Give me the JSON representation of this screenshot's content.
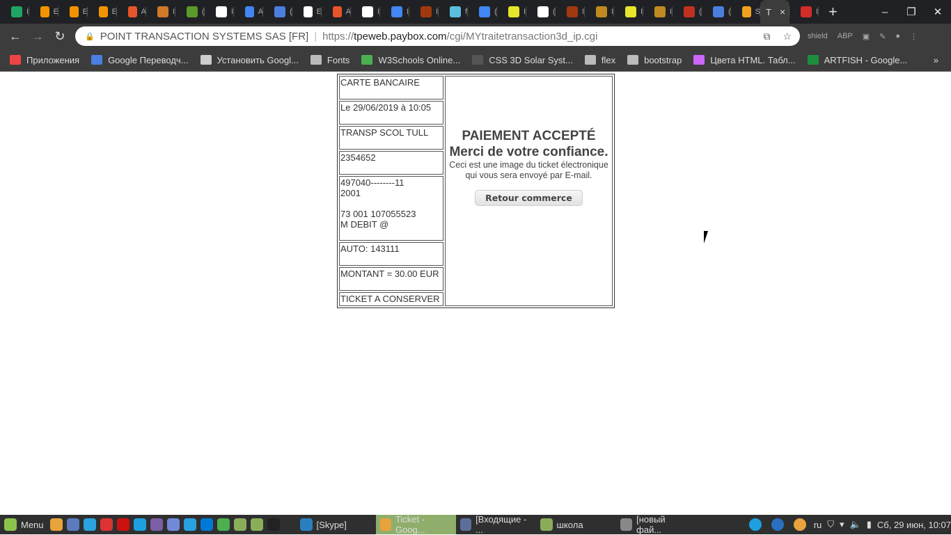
{
  "browser": {
    "tabs": [
      {
        "icon": "google-drive-icon",
        "color": "#1fa463",
        "label": "I"
      },
      {
        "icon": "af-icon",
        "color": "#f29400",
        "label": "E"
      },
      {
        "icon": "af-icon",
        "color": "#f29400",
        "label": "E"
      },
      {
        "icon": "af-icon",
        "color": "#f29400",
        "label": "E"
      },
      {
        "icon": "asterisk-icon",
        "color": "#e8542a",
        "label": "A"
      },
      {
        "icon": "mountain-icon",
        "color": "#d07a28",
        "label": "I"
      },
      {
        "icon": "frog-icon",
        "color": "#5a9a2a",
        "label": "("
      },
      {
        "icon": "globe-icon",
        "color": "#ffffff",
        "label": "I"
      },
      {
        "icon": "google-icon",
        "color": "#4285f4",
        "label": "A"
      },
      {
        "icon": "google-translate-icon",
        "color": "#4a7fe0",
        "label": "("
      },
      {
        "icon": "globe-icon",
        "color": "#ffffff",
        "label": "E"
      },
      {
        "icon": "asterisk-icon",
        "color": "#e8542a",
        "label": "A"
      },
      {
        "icon": "globe-icon",
        "color": "#ffffff",
        "label": "I"
      },
      {
        "icon": "google-icon",
        "color": "#4285f4",
        "label": "I"
      },
      {
        "icon": "blocks-icon",
        "color": "#a0380f",
        "label": "I"
      },
      {
        "icon": "codepen-cloud-icon",
        "color": "#5bc0de",
        "label": "f"
      },
      {
        "icon": "google-icon",
        "color": "#4285f4",
        "label": "("
      },
      {
        "icon": "warning-icon",
        "color": "#e6e62a",
        "label": "I"
      },
      {
        "icon": "codepen-icon",
        "color": "#ffffff",
        "label": "("
      },
      {
        "icon": "blocks-icon",
        "color": "#a0380f",
        "label": "I"
      },
      {
        "icon": "glasses-icon",
        "color": "#c08a20",
        "label": "I"
      },
      {
        "icon": "warning-icon",
        "color": "#e6e62a",
        "label": "I"
      },
      {
        "icon": "glasses-icon",
        "color": "#c08a20",
        "label": "I"
      },
      {
        "icon": "spiral-icon",
        "color": "#c03020",
        "label": "("
      },
      {
        "icon": "google-translate-icon",
        "color": "#4a7fe0",
        "label": "("
      },
      {
        "icon": "gfi-icon",
        "color": "#f0a020",
        "label": "S"
      }
    ],
    "active_tab": {
      "label": "T",
      "close": "×"
    },
    "after_tabs": [
      {
        "icon": "lastpass-icon",
        "color": "#d32d27",
        "label": "I"
      }
    ],
    "new_tab": "+",
    "window_controls": {
      "minimize": "–",
      "maximize": "❐",
      "close": "✕"
    },
    "nav": {
      "back": "←",
      "forward": "→",
      "reload": "↻"
    },
    "address": {
      "site_name": "POINT TRANSACTION SYSTEMS SAS [FR]",
      "scheme": "https://",
      "host": "tpeweb.paybox.com",
      "path": "/cgi/MYtraitetransaction3d_ip.cgi",
      "translate": "⧉",
      "star": "☆"
    },
    "extensions": [
      "shield",
      "ABP",
      "▣",
      "✎",
      "●",
      "⋮"
    ],
    "bookmarks": [
      {
        "label": "Приложения",
        "color": "#e44"
      },
      {
        "label": "Google Переводч...",
        "color": "#4a7fe0"
      },
      {
        "label": "Установить Googl...",
        "color": "#ccc"
      },
      {
        "label": "Fonts",
        "color": "#bbb"
      },
      {
        "label": "W3Schools Online...",
        "color": "#4caf50"
      },
      {
        "label": "CSS 3D Solar Syst...",
        "color": "#555"
      },
      {
        "label": "flex",
        "color": "#bbb"
      },
      {
        "label": "bootstrap",
        "color": "#bbb"
      },
      {
        "label": "Цвета HTML. Табл...",
        "color": "#c6f"
      },
      {
        "label": "ARTFISH - Google...",
        "color": "#1e8e3e"
      }
    ],
    "bookmarks_more": "»"
  },
  "ticket": {
    "rows": [
      "CARTE BANCAIRE",
      "Le 29/06/2019 à 10:05",
      "TRANSP SCOL TULL",
      "2354652",
      "497040--------11\n2001\n\n73 001 107055523\nM DEBIT @",
      "AUTO: 143111",
      "MONTANT = 30.00 EUR",
      "TICKET A CONSERVER"
    ],
    "status": "PAIEMENT ACCEPTÉ",
    "thanks": "Merci de votre confiance.",
    "note_line1": "Ceci est une image du ticket électronique",
    "note_line2": "qui vous sera envoyé par E-mail.",
    "button": "Retour commerce"
  },
  "taskbar": {
    "menu": "Menu",
    "launchers": [
      "#e8a33d",
      "#5b7bbd",
      "#2aa3e0",
      "#d33",
      "#c11",
      "#1ea0e0",
      "#7b5ea7",
      "#7289da",
      "#2aa0e0",
      "#0078d7",
      "#4caf50",
      "#8aad5a",
      "#8aad5a",
      "#222"
    ],
    "windows": [
      {
        "label": "[Skype]",
        "color": "#2a7fc0",
        "active": false
      },
      {
        "label": "Ticket - Goog...",
        "color": "#e8a33d",
        "active": true
      },
      {
        "label": "[Входящие - ...",
        "color": "#5b6f9a",
        "active": false
      },
      {
        "label": "школа",
        "color": "#8aad5a",
        "active": false
      },
      {
        "label": "[новый фай...",
        "color": "#888",
        "active": false
      }
    ],
    "lang": "ru",
    "clock": "Сб, 29 июн, 10:07"
  }
}
